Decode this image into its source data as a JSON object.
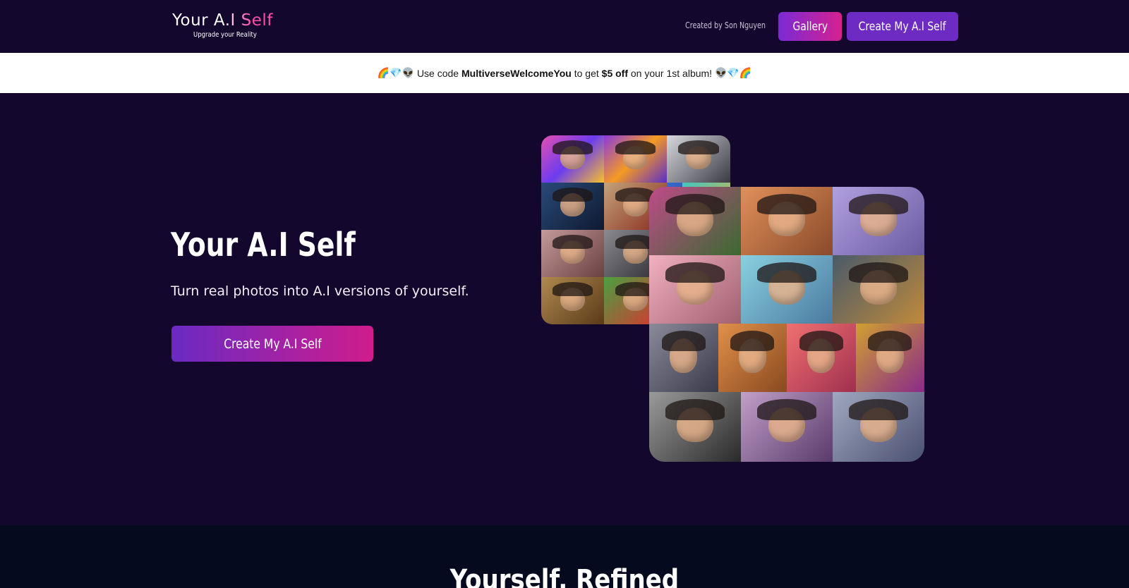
{
  "header": {
    "logo_title": "Your A.I Self",
    "logo_subtitle": "Upgrade your Reality",
    "created_by": "Created by Son Nguyen",
    "gallery_label": "Gallery",
    "create_label": "Create My A.I Self"
  },
  "promo": {
    "emoji_left": "🌈💎👽",
    "text_1": "Use code",
    "code": "MultiverseWelcomeYou",
    "text_2": "to get",
    "discount": "$5 off",
    "text_3": "on your 1st album!",
    "emoji_right": "👽💎🌈"
  },
  "hero": {
    "title": "Your A.I Self",
    "subtitle": "Turn real photos into A.I versions of yourself.",
    "cta_label": "Create My A.I Self"
  },
  "colors": {
    "background": "#14072e",
    "accent_purple": "#6e2bc4",
    "accent_pink": "#d6218f",
    "promo_background": "#ffffff",
    "section2_background": "#060a1e"
  },
  "section2": {
    "title": "Yourself, Refined"
  }
}
